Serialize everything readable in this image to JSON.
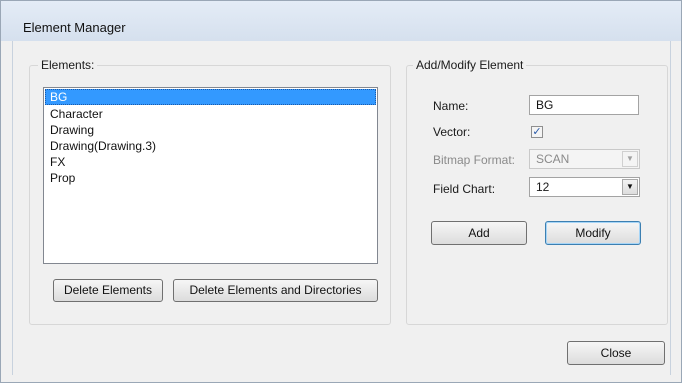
{
  "window": {
    "title": "Element Manager"
  },
  "elements_group": {
    "label": "Elements:",
    "items": [
      "BG",
      "Character",
      "Drawing",
      "Drawing(Drawing.3)",
      "FX",
      "Prop"
    ],
    "selected": "BG",
    "delete_elements_label": "Delete Elements",
    "delete_elements_dirs_label": "Delete Elements and Directories"
  },
  "modify_group": {
    "label": "Add/Modify Element",
    "name_label": "Name:",
    "name_value": "BG",
    "vector_label": "Vector:",
    "vector_checked": true,
    "vector_check_glyph": "✓",
    "bitmap_label": "Bitmap Format:",
    "bitmap_value": "SCAN",
    "field_chart_label": "Field Chart:",
    "field_chart_value": "12",
    "add_label": "Add",
    "modify_label": "Modify"
  },
  "footer": {
    "close_label": "Close"
  },
  "icons": {
    "dropdown": "chevron-down-icon",
    "checkbox": "checkmark-icon"
  },
  "colors": {
    "selection": "#3399ff",
    "titlebar": "#dfe8f3",
    "default_button_border": "#3c7fb1"
  }
}
